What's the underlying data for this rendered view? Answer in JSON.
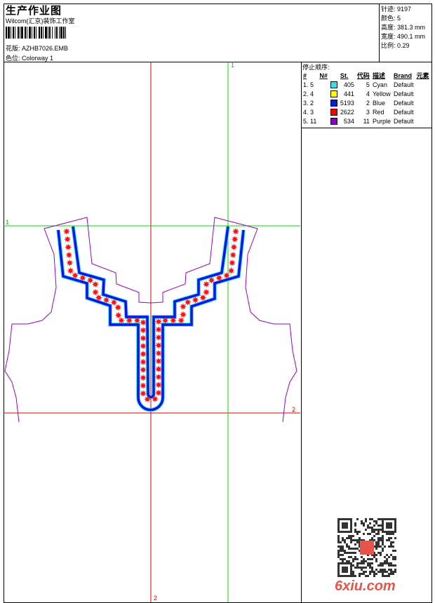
{
  "header": {
    "title": "生产作业图",
    "company": "Wilcom(汇京)装饰工作室",
    "design_label": "花版:",
    "design_value": "AZHB7026.EMB",
    "colorway_label": "色位:",
    "colorway_value": "Colorway 1"
  },
  "stats": [
    {
      "label": "针迹:",
      "value": "9197"
    },
    {
      "label": "颜色:",
      "value": "5"
    },
    {
      "label": "高度:",
      "value": "381.3 mm"
    },
    {
      "label": "宽度:",
      "value": "490.1 mm"
    },
    {
      "label": "比例:",
      "value": "0.29"
    }
  ],
  "stop_sequence": {
    "title": "停止顺序:",
    "columns": [
      "#",
      "N#",
      "",
      "St.",
      "代码",
      "描述",
      "Brand",
      "元素"
    ],
    "rows": [
      {
        "idx": "1.",
        "n": "5",
        "color": "#33e0e8",
        "st": "405",
        "code": "5",
        "desc": "Cyan",
        "brand": "Default"
      },
      {
        "idx": "2.",
        "n": "4",
        "color": "#ffff00",
        "st": "441",
        "code": "4",
        "desc": "Yellow",
        "brand": "Default"
      },
      {
        "idx": "3.",
        "n": "2",
        "color": "#0020e0",
        "st": "5193",
        "code": "2",
        "desc": "Blue",
        "brand": "Default"
      },
      {
        "idx": "4.",
        "n": "3",
        "color": "#ff0000",
        "st": "2622",
        "code": "3",
        "desc": "Red",
        "brand": "Default"
      },
      {
        "idx": "5.",
        "n": "11",
        "color": "#8a00c8",
        "st": "534",
        "code": "11",
        "desc": "Purple",
        "brand": "Default"
      }
    ]
  },
  "guides": {
    "green_label_h": "1",
    "green_label_v": "1",
    "red_label_h": "2",
    "red_label_v": "2"
  },
  "watermark": "6xiu.com",
  "colors": {
    "outline": "#9a00d0",
    "blue": "#0a14e6",
    "cyan": "#3ae6f0",
    "red": "#ff1010",
    "green": "#00e000",
    "guide_red": "#e00000"
  }
}
